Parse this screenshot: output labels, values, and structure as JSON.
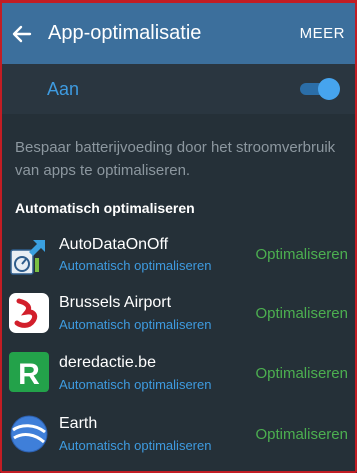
{
  "appbar": {
    "title": "App-optimalisatie",
    "more_label": "MEER"
  },
  "master": {
    "label": "Aan",
    "toggle_on": true
  },
  "description": "Bespaar batterijvoeding door het stroomverbruik van apps te optimaliseren.",
  "section_header": "Automatisch optimaliseren",
  "apps": [
    {
      "name": "AutoDataOnOff",
      "status": "Automatisch optimaliseren",
      "action": "Optimaliseren",
      "icon": "autodata-icon"
    },
    {
      "name": "Brussels Airport",
      "status": "Automatisch optimaliseren",
      "action": "Optimaliseren",
      "icon": "brussels-airport-icon"
    },
    {
      "name": "deredactie.be",
      "status": "Automatisch optimaliseren",
      "action": "Optimaliseren",
      "icon": "deredactie-icon"
    },
    {
      "name": "Earth",
      "status": "Automatisch optimaliseren",
      "action": "Optimaliseren",
      "icon": "earth-icon"
    }
  ],
  "colors": {
    "appbar": "#3c6f9c",
    "background": "#253038",
    "accent": "#3e9be0",
    "action": "#4caf50",
    "frame": "#c21d24"
  }
}
